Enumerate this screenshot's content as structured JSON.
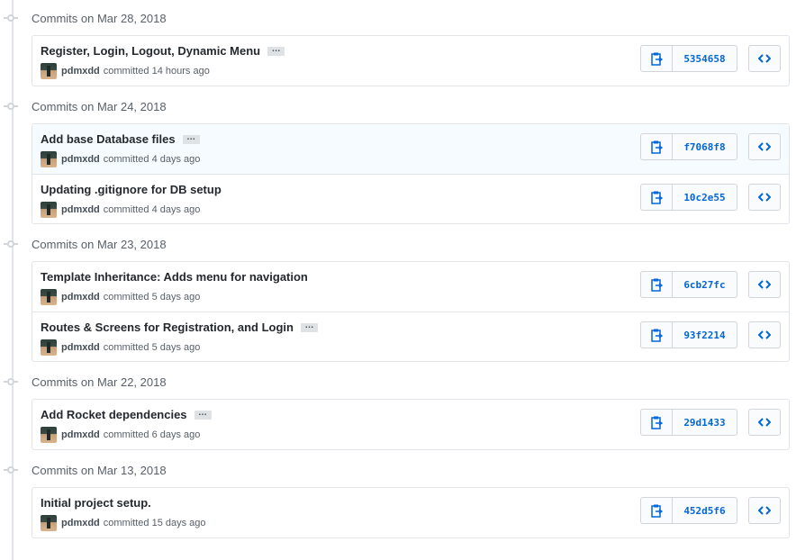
{
  "colors": {
    "sha_link": "#0366d6",
    "border": "#e1e4e8",
    "highlight_row": "#f6fbff"
  },
  "groups": [
    {
      "label": "Commits on Mar 28, 2018",
      "commits": [
        {
          "message": "Register, Login, Logout, Dynamic Menu",
          "has_ellipsis": true,
          "ellipsis": "…",
          "author": "pdmxdd",
          "action": "committed",
          "time": "14 hours ago",
          "sha": "5354658"
        }
      ]
    },
    {
      "label": "Commits on Mar 24, 2018",
      "commits": [
        {
          "message": "Add base Database files",
          "has_ellipsis": true,
          "ellipsis": "…",
          "author": "pdmxdd",
          "action": "committed",
          "time": "4 days ago",
          "sha": "f7068f8",
          "highlighted": true
        },
        {
          "message": "Updating .gitignore for DB setup",
          "has_ellipsis": false,
          "author": "pdmxdd",
          "action": "committed",
          "time": "4 days ago",
          "sha": "10c2e55"
        }
      ]
    },
    {
      "label": "Commits on Mar 23, 2018",
      "commits": [
        {
          "message": "Template Inheritance: Adds menu for navigation",
          "has_ellipsis": false,
          "author": "pdmxdd",
          "action": "committed",
          "time": "5 days ago",
          "sha": "6cb27fc"
        },
        {
          "message": "Routes & Screens for Registration, and Login",
          "has_ellipsis": true,
          "ellipsis": "…",
          "author": "pdmxdd",
          "action": "committed",
          "time": "5 days ago",
          "sha": "93f2214"
        }
      ]
    },
    {
      "label": "Commits on Mar 22, 2018",
      "commits": [
        {
          "message": "Add Rocket dependencies",
          "has_ellipsis": true,
          "ellipsis": "…",
          "author": "pdmxdd",
          "action": "committed",
          "time": "6 days ago",
          "sha": "29d1433"
        }
      ]
    },
    {
      "label": "Commits on Mar 13, 2018",
      "commits": [
        {
          "message": "Initial project setup.",
          "has_ellipsis": false,
          "author": "pdmxdd",
          "action": "committed",
          "time": "15 days ago",
          "sha": "452d5f6"
        }
      ]
    }
  ],
  "icons": {
    "copy": "clipboard-icon",
    "browse": "code-brackets-icon",
    "timeline_node": "commit-node-icon"
  }
}
